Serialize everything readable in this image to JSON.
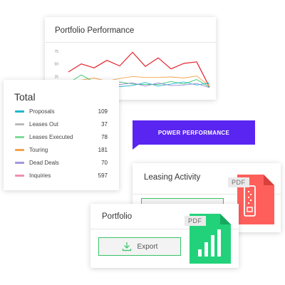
{
  "portfolio_performance": {
    "title": "Portfolio Performance"
  },
  "chart_data": {
    "type": "line",
    "title": "Portfolio Performance",
    "x": [
      0,
      1,
      2,
      3,
      4,
      5,
      6,
      7,
      8,
      9,
      10,
      11
    ],
    "ylim": [
      0,
      75
    ],
    "yticks": [
      "0",
      "25",
      "50",
      "75"
    ],
    "grid": false,
    "series": [
      {
        "color": "#e2222c",
        "values": [
          34,
          50,
          42,
          57,
          46,
          73,
          45,
          62,
          40,
          51,
          54,
          4
        ]
      },
      {
        "color": "#f5a34a",
        "values": [
          16,
          18,
          22,
          16,
          21,
          25,
          23,
          23,
          24,
          22,
          26,
          6
        ]
      },
      {
        "color": "#36c76e",
        "values": [
          12,
          28,
          14,
          8,
          14,
          10,
          9,
          9,
          15,
          10,
          19,
          4
        ]
      },
      {
        "color": "#1fb6c9",
        "values": [
          8,
          14,
          6,
          13,
          5,
          7,
          13,
          6,
          10,
          14,
          8,
          12
        ]
      },
      {
        "color": "#9a86d8",
        "values": [
          14,
          11,
          9,
          5,
          9,
          12,
          6,
          12,
          7,
          8,
          11,
          3
        ]
      }
    ]
  },
  "total": {
    "title": "Total",
    "items": [
      {
        "label": "Proposals",
        "count": "109",
        "color": "#1fb6c9"
      },
      {
        "label": "Leases Out",
        "count": "37",
        "color": "#b9b9b9"
      },
      {
        "label": "Leases Executed",
        "count": "78",
        "color": "#7edb97"
      },
      {
        "label": "Touring",
        "count": "181",
        "color": "#f5a34a"
      },
      {
        "label": "Dead Deals",
        "count": "70",
        "color": "#a596dd"
      },
      {
        "label": "Inquiries",
        "count": "597",
        "color": "#f08eb0"
      }
    ]
  },
  "power_banner": {
    "text": "POWER PERFORMANCE",
    "color": "#5a25f0"
  },
  "leasing_activity": {
    "title": "Leasing Activity"
  },
  "portfolio": {
    "title": "Portfolio",
    "export_label": "Export"
  },
  "pdf_icons": {
    "red_tag": "PDF",
    "red_color": "#ff5f5b",
    "red_icon": "document-icon",
    "green_tag": "PDF",
    "green_color": "#22d27a",
    "green_icon": "bar-chart-icon"
  }
}
